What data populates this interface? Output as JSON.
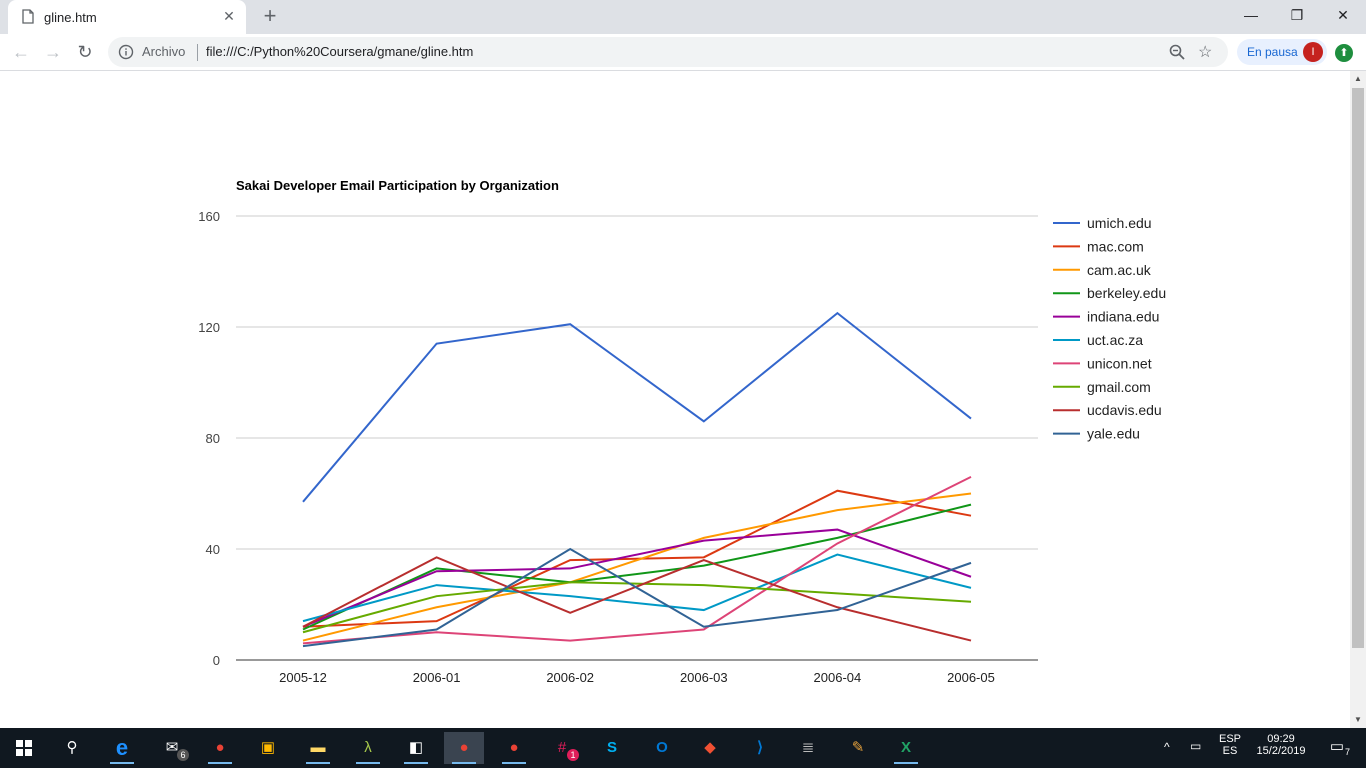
{
  "browser": {
    "tab_title": "gline.htm",
    "tab_close": "✕",
    "new_tab": "+",
    "security_label": "Archivo",
    "url": "file:///C:/Python%20Coursera/gmane/gline.htm",
    "profile_label": "En pausa",
    "profile_initial": "I",
    "window_controls": [
      "—",
      "❐",
      "✕"
    ]
  },
  "chart_data": {
    "type": "line",
    "title": "Sakai Developer Email Participation by Organization",
    "categories": [
      "2005-12",
      "2006-01",
      "2006-02",
      "2006-03",
      "2006-04",
      "2006-05"
    ],
    "ylim": [
      0,
      160
    ],
    "yticks": [
      0,
      40,
      80,
      120,
      160
    ],
    "grid": true,
    "legend_position": "right",
    "series": [
      {
        "name": "umich.edu",
        "color": "#3366cc",
        "values": [
          57,
          114,
          121,
          86,
          125,
          87
        ]
      },
      {
        "name": "mac.com",
        "color": "#dc3912",
        "values": [
          12,
          14,
          36,
          37,
          61,
          52
        ]
      },
      {
        "name": "cam.ac.uk",
        "color": "#ff9900",
        "values": [
          7,
          19,
          28,
          44,
          54,
          60
        ]
      },
      {
        "name": "berkeley.edu",
        "color": "#109618",
        "values": [
          11,
          33,
          28,
          34,
          44,
          56
        ]
      },
      {
        "name": "indiana.edu",
        "color": "#990099",
        "values": [
          12,
          32,
          33,
          43,
          47,
          30
        ]
      },
      {
        "name": "uct.ac.za",
        "color": "#0099c6",
        "values": [
          14,
          27,
          23,
          18,
          38,
          26
        ]
      },
      {
        "name": "unicon.net",
        "color": "#dd4477",
        "values": [
          6,
          10,
          7,
          11,
          42,
          66
        ]
      },
      {
        "name": "gmail.com",
        "color": "#66aa00",
        "values": [
          10,
          23,
          28,
          27,
          24,
          21
        ]
      },
      {
        "name": "ucdavis.edu",
        "color": "#b82e2e",
        "values": [
          12,
          37,
          17,
          36,
          19,
          7
        ]
      },
      {
        "name": "yale.edu",
        "color": "#316395",
        "values": [
          5,
          11,
          40,
          12,
          18,
          35
        ]
      }
    ]
  },
  "taskbar": {
    "lang_top": "ESP",
    "lang_bottom": "ES",
    "time": "09:29",
    "date": "15/2/2019",
    "mail_badge": "6",
    "slack_badge": "1",
    "notif_count": "7"
  }
}
